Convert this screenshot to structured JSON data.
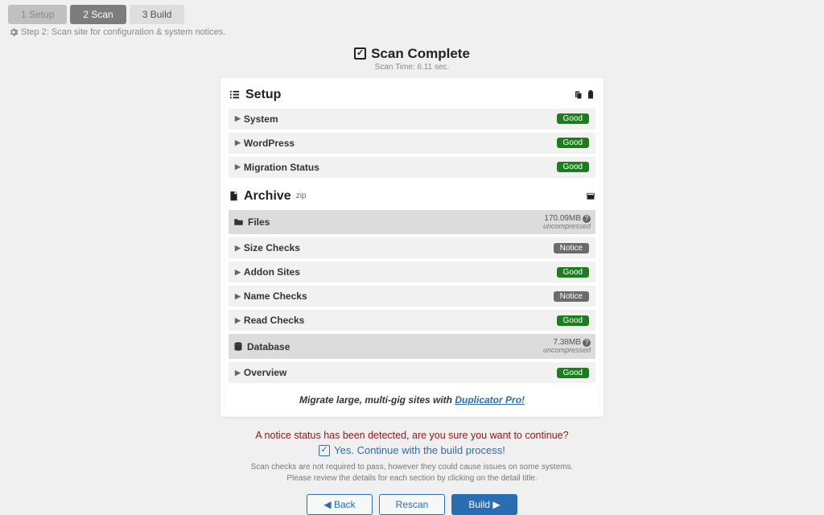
{
  "tabs": {
    "setup": "1 Setup",
    "scan": "2 Scan",
    "build": "3 Build"
  },
  "subline": "Step 2: Scan site for configuration & system notices.",
  "header": {
    "title": "Scan Complete",
    "scan_time": "Scan Time: 6.11 sec."
  },
  "setup_section": {
    "title": "Setup",
    "rows": {
      "system": {
        "label": "System",
        "status": "Good"
      },
      "wordpress": {
        "label": "WordPress",
        "status": "Good"
      },
      "migration": {
        "label": "Migration Status",
        "status": "Good"
      }
    }
  },
  "archive_section": {
    "title": "Archive",
    "suffix": "zip",
    "files": {
      "label": "Files",
      "size": "170.09MB",
      "note": "uncompressed",
      "rows": {
        "size_checks": {
          "label": "Size Checks",
          "status": "Notice"
        },
        "addon_sites": {
          "label": "Addon Sites",
          "status": "Good"
        },
        "name_checks": {
          "label": "Name Checks",
          "status": "Notice"
        },
        "read_checks": {
          "label": "Read Checks",
          "status": "Good"
        }
      }
    },
    "database": {
      "label": "Database",
      "size": "7.38MB",
      "note": "uncompressed",
      "rows": {
        "overview": {
          "label": "Overview",
          "status": "Good"
        }
      }
    }
  },
  "promo": {
    "text": "Migrate large, multi-gig sites with ",
    "link": "Duplicator Pro!"
  },
  "footer": {
    "warn": "A notice status has been detected, are you sure you want to continue?",
    "continue": "Yes. Continue with the build process!",
    "fine1": "Scan checks are not required to pass, however they could cause issues on some systems.",
    "fine2": "Please review the details for each section by clicking on the detail title."
  },
  "buttons": {
    "back": "◀ Back",
    "rescan": "Rescan",
    "build": "Build ▶"
  }
}
